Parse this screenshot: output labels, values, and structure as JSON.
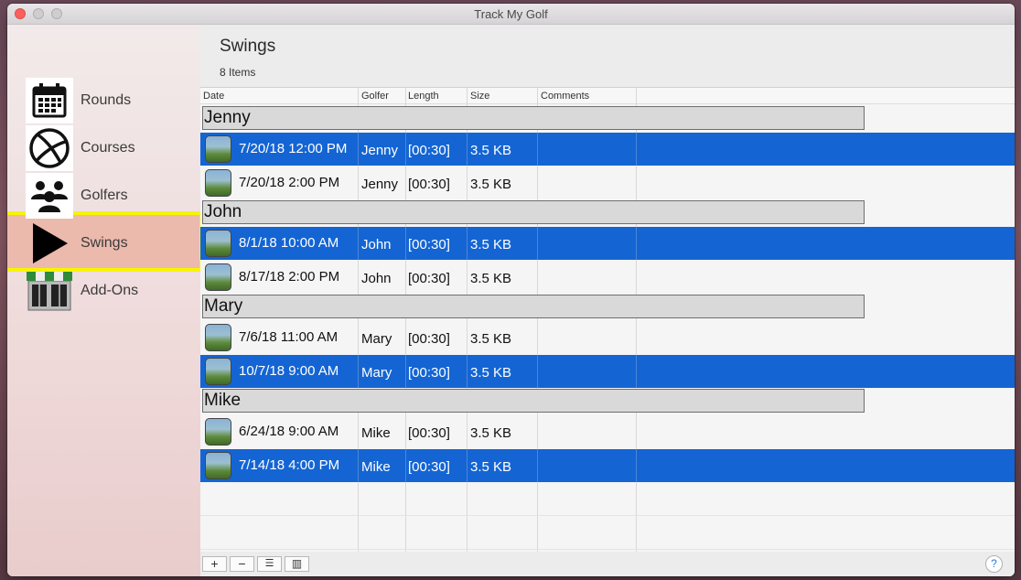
{
  "window": {
    "title": "Track My Golf"
  },
  "sidebar": {
    "items": [
      {
        "label": "Rounds",
        "icon": "calendar-icon"
      },
      {
        "label": "Courses",
        "icon": "globe-icon"
      },
      {
        "label": "Golfers",
        "icon": "people-icon"
      },
      {
        "label": "Swings",
        "icon": "play-icon",
        "selected": true
      },
      {
        "label": "Add-Ons",
        "icon": "storefront-icon"
      }
    ]
  },
  "main": {
    "title": "Swings",
    "count": "8 Items",
    "columns": [
      "Date",
      "Golfer",
      "Length",
      "Size",
      "Comments"
    ],
    "groups": [
      {
        "name": "Jenny",
        "rows": [
          {
            "date": "7/20/18 12:00 PM",
            "golfer": "Jenny",
            "length": "[00:30]",
            "size": "3.5 KB",
            "selected": true
          },
          {
            "date": "7/20/18 2:00 PM",
            "golfer": "Jenny",
            "length": "[00:30]",
            "size": "3.5 KB",
            "selected": false
          }
        ]
      },
      {
        "name": "John",
        "rows": [
          {
            "date": "8/1/18 10:00 AM",
            "golfer": "John",
            "length": "[00:30]",
            "size": "3.5 KB",
            "selected": true
          },
          {
            "date": "8/17/18 2:00 PM",
            "golfer": "John",
            "length": "[00:30]",
            "size": "3.5 KB",
            "selected": false
          }
        ]
      },
      {
        "name": "Mary",
        "rows": [
          {
            "date": "7/6/18 11:00 AM",
            "golfer": "Mary",
            "length": "[00:30]",
            "size": "3.5 KB",
            "selected": false
          },
          {
            "date": "10/7/18 9:00 AM",
            "golfer": "Mary",
            "length": "[00:30]",
            "size": "3.5 KB",
            "selected": true
          }
        ]
      },
      {
        "name": "Mike",
        "rows": [
          {
            "date": "6/24/18 9:00 AM",
            "golfer": "Mike",
            "length": "[00:30]",
            "size": "3.5 KB",
            "selected": false
          },
          {
            "date": "7/14/18 4:00 PM",
            "golfer": "Mike",
            "length": "[00:30]",
            "size": "3.5 KB",
            "selected": true
          }
        ]
      }
    ]
  },
  "toolbar": {
    "add": "+",
    "remove": "−",
    "list": "☰",
    "columns": "▥",
    "help": "?"
  },
  "colors": {
    "selection": "#1465d3",
    "highlight": "#f7f400",
    "sidebar_selected": "#ecb9ad"
  }
}
